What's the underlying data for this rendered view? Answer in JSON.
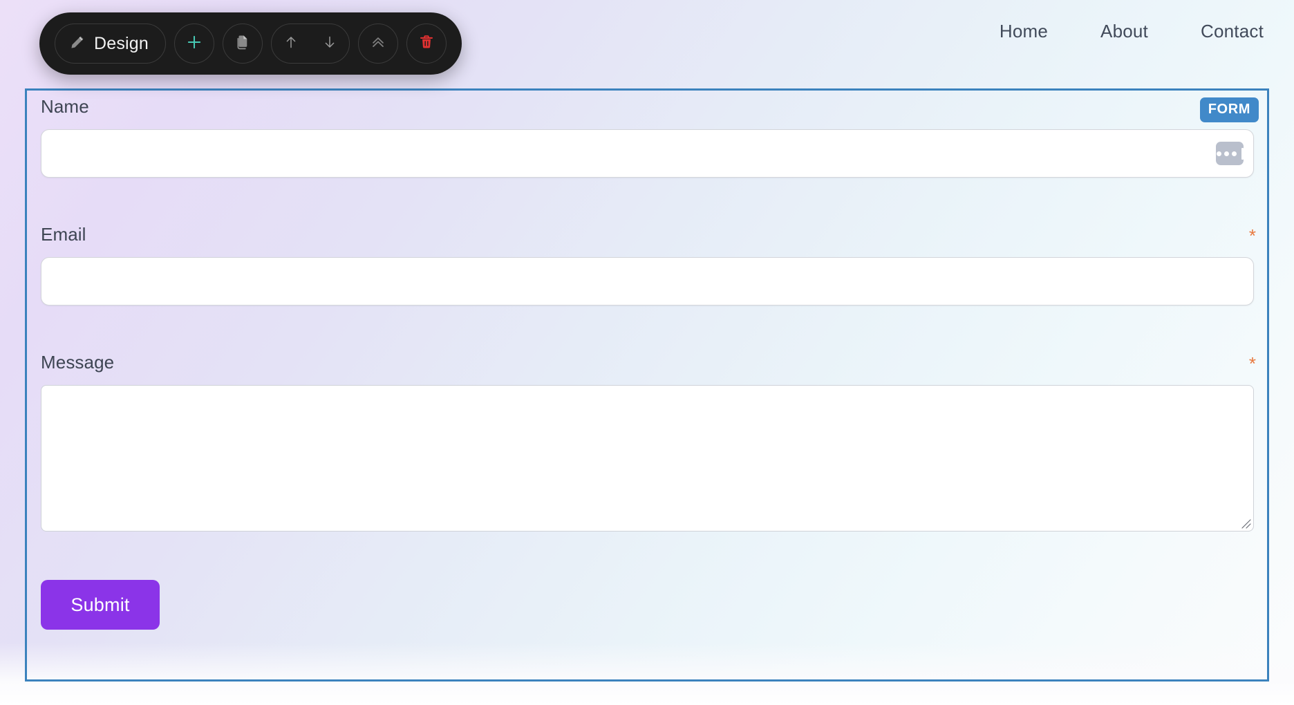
{
  "app": {
    "canvas_gradient_start": "#ece0f8",
    "canvas_gradient_end": "#fbfcfd"
  },
  "site_nav": {
    "items": [
      {
        "label": "Home"
      },
      {
        "label": "About"
      },
      {
        "label": "Contact"
      }
    ]
  },
  "toolbar": {
    "mode_label": "Design",
    "mode_icon": "pencil-icon",
    "buttons": [
      {
        "name": "add-block-button",
        "icon": "plus-icon",
        "color": "#47c9b4"
      },
      {
        "name": "duplicate-block-button",
        "icon": "copy-icon",
        "color": "#8a8a8a"
      },
      {
        "name": "move-up-button",
        "icon": "arrow-up-icon",
        "color": "#9a9a9a"
      },
      {
        "name": "move-down-button",
        "icon": "arrow-down-icon",
        "color": "#9a9a9a"
      },
      {
        "name": "collapse-button",
        "icon": "double-chevron-up-icon",
        "color": "#7d7d7d"
      },
      {
        "name": "delete-block-button",
        "icon": "trash-icon",
        "color": "#e03131"
      }
    ]
  },
  "form_block": {
    "badge": "FORM",
    "badge_color": "#4189c9",
    "selection_color": "#3b82bd",
    "required_marker": "*",
    "required_marker_color": "#e8793f",
    "fields": [
      {
        "label": "Name",
        "type": "text",
        "value": "",
        "placeholder": "",
        "required": true,
        "has_handle": true
      },
      {
        "label": "Email",
        "type": "text",
        "value": "",
        "placeholder": "",
        "required": true,
        "has_handle": false
      },
      {
        "label": "Message",
        "type": "textarea",
        "value": "",
        "placeholder": "",
        "required": true,
        "has_handle": false
      }
    ],
    "submit_label": "Submit",
    "submit_color": "#8b34e8"
  }
}
